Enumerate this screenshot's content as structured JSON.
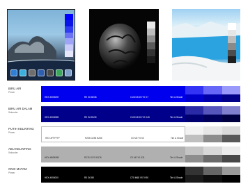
{
  "images": [
    {
      "name": "beach-rocks-photo",
      "swatches": [
        "#0000ff",
        "#0a14e6",
        "#2f3cf0",
        "#6c73f2",
        "#9ea4f6",
        "#c9ccf9",
        "#e6e7fb"
      ]
    },
    {
      "name": "dark-sphere-photo",
      "swatches": [
        "#e8e8e8",
        "#bdbdbd",
        "#8e8e8e",
        "#5a5a5a",
        "#333333",
        "#1a1a1a"
      ]
    },
    {
      "name": "lake-quarry-photo",
      "swatches": [
        "#ffffff",
        "#e6e6e6",
        "#bdbdbd",
        "#8a8a8a",
        "#4d4d4d",
        "#1f1f1f"
      ]
    }
  ],
  "dock_colors": [
    "#2f7fd6",
    "#3bb0e0",
    "#6e6e6e",
    "#2f5fb0",
    "#4a4a4a",
    "#3aa85a",
    "#7ea0c8"
  ],
  "rows": [
    {
      "name": "BIRU AIR",
      "sub": "Primer",
      "bar_color": "#0000ee",
      "text_color": "#ffffff",
      "hex": "HEX #0000EE",
      "rgb": "R0 G0 B238",
      "cmyk": "C100 M100 Y0 K7",
      "tints_label": "Tint & Shade",
      "tints": [
        [
          "#3333f5",
          "#6666f8",
          "#9999fb"
        ],
        [
          "#0000cc",
          "#0000aa",
          "#000088"
        ]
      ]
    },
    {
      "name": "BIRU AIR DALAM",
      "sub": "Sekunder",
      "bar_color": "#00008b",
      "text_color": "#ffffff",
      "hex": "HEX #00008B",
      "rgb": "R0 G0 B139",
      "cmyk": "C100 M100 Y0 K45",
      "tints_label": "Tint & Shade",
      "tints": [
        [
          "#2a2aa6",
          "#5555bb",
          "#8080cf"
        ],
        [
          "#000070",
          "#00005a",
          "#000040"
        ]
      ]
    },
    {
      "name": "PUTIH KELINTING",
      "sub": "Primer",
      "bar_color": "#ffffff",
      "text_color": "#333333",
      "hex": "HEX #FFFFFF",
      "rgb": "R255 G255 B255",
      "cmyk": "C0 M0 Y0 K0",
      "tints_label": "Tint & Shade",
      "tints": [
        [
          "#f2f2f2",
          "#e6e6e6",
          "#d9d9d9"
        ],
        [
          "#bfbfbf",
          "#8c8c8c",
          "#595959"
        ]
      ]
    },
    {
      "name": "ABU KELINTING",
      "sub": "Sekunder",
      "bar_color": "#b0b0b0",
      "text_color": "#222222",
      "hex": "HEX #B0B0B0",
      "rgb": "R176 G176 B176",
      "cmyk": "C0 M0 Y0 K31",
      "tints_label": "Tint & Shade",
      "tints": [
        [
          "#c4c4c4",
          "#d8d8d8",
          "#ebebeb"
        ],
        [
          "#8d8d8d",
          "#6a6a6a",
          "#474747"
        ]
      ]
    },
    {
      "name": "ONIX MATAM",
      "sub": "Primer",
      "bar_color": "#000000",
      "text_color": "#ffffff",
      "hex": "HEX #000000",
      "rgb": "R0 G0 B0",
      "cmyk": "C75 M68 Y67 K90",
      "tints_label": "Tint & Shade",
      "tints": [
        [
          "#333333",
          "#666666",
          "#999999"
        ],
        [
          "#1a1a1a",
          "#0d0d0d",
          "#000000"
        ]
      ]
    }
  ]
}
